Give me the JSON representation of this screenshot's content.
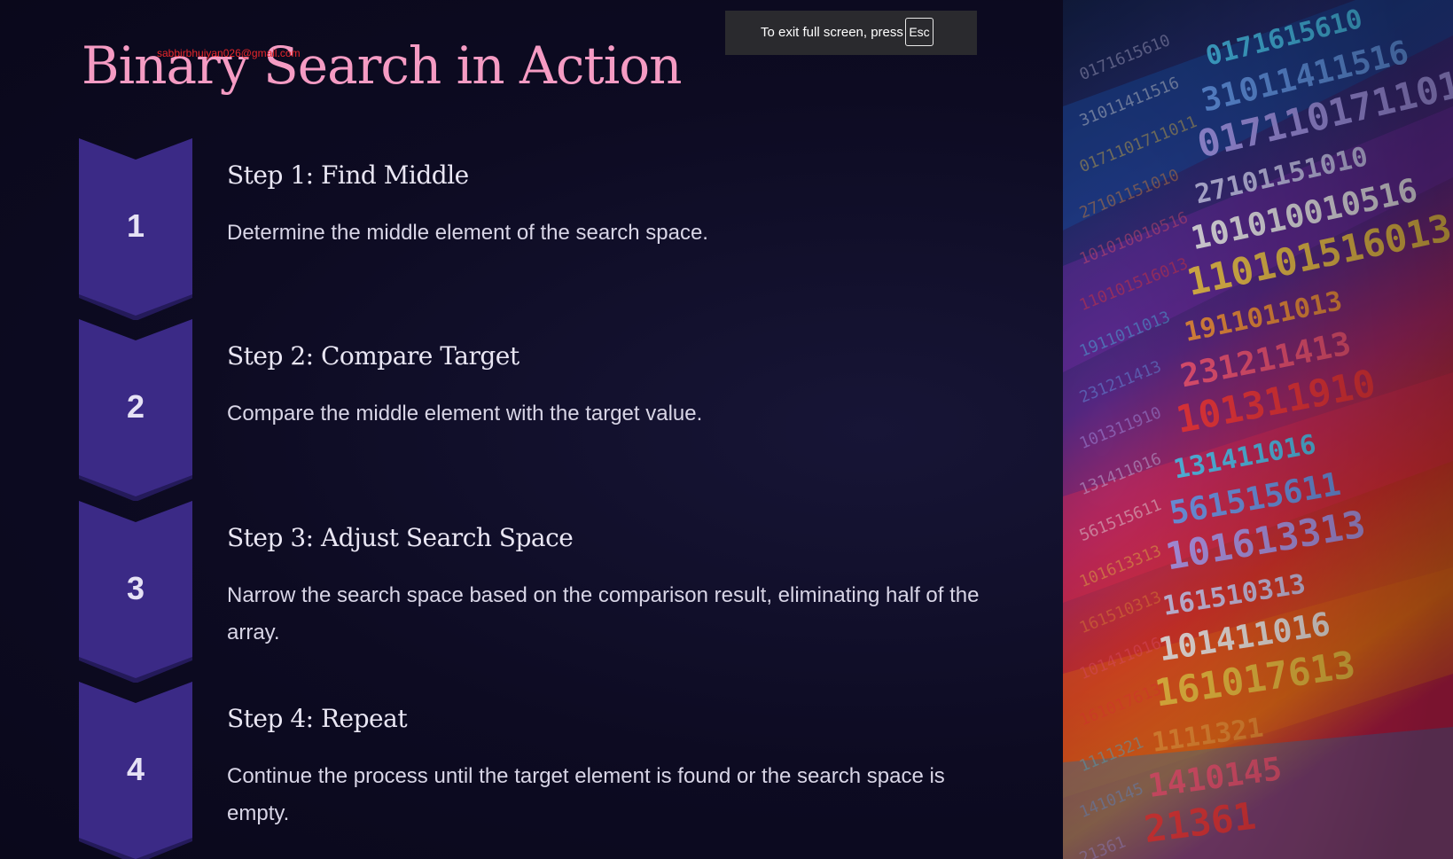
{
  "slide": {
    "title": "Binary Search in Action",
    "watermark": "sabbirbhuiyan026@gmail.com",
    "steps": [
      {
        "number": "1",
        "title": "Step 1: Find Middle",
        "description": "Determine the middle element of the search space."
      },
      {
        "number": "2",
        "title": "Step 2: Compare Target",
        "description": "Compare the middle element with the target value."
      },
      {
        "number": "3",
        "title": "Step 3: Adjust Search Space",
        "description": "Narrow the search space based on the comparison result, eliminating half of the array."
      },
      {
        "number": "4",
        "title": "Step 4: Repeat",
        "description": "Continue the process until the target element is found or the search space is empty."
      }
    ]
  },
  "fullscreen_toast": {
    "message": "To exit full screen, press",
    "key": "Esc"
  },
  "image_panel": {
    "description_icon": "binary-code-matrix-image",
    "digit_rows": [
      "0171615610",
      "31011411516",
      "0171101711011",
      "27101151010",
      "101010010516",
      "110101516013",
      "1911011013",
      "231211413",
      "101311910",
      "131411016",
      "561515611",
      "101613313",
      "161510313",
      "101411016",
      "161017613",
      "1111321",
      "1410145",
      "21361"
    ]
  },
  "colors": {
    "background": "#0d0b22",
    "title": "#f59bc3",
    "badge": "#3b2a86",
    "badge_shadow": "#241a5a",
    "text": "#d8d5e6",
    "watermark": "#e8262a",
    "toast": "#2a2a2e"
  }
}
